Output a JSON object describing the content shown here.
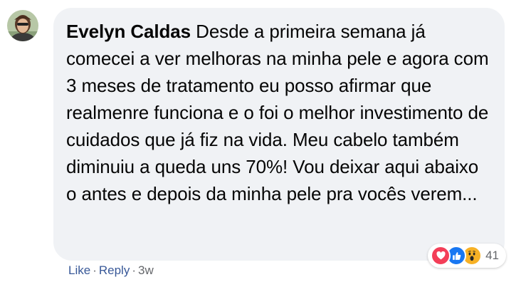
{
  "comment": {
    "author": "Evelyn Caldas",
    "text": "Desde a primeira semana já comecei a ver melhoras na minha pele e agora com 3 meses de tratamento eu posso afirmar que realmenre funciona e o foi o melhor investimento de cuidados que já fiz na vida. Meu cabelo também diminuiu a queda uns 70%! Vou deixar aqui abaixo o antes e depois da minha pele pra vocês verem..."
  },
  "reactions": {
    "icons": [
      "love-icon",
      "like-icon",
      "wow-icon"
    ],
    "count": "41"
  },
  "actions": {
    "like": "Like",
    "separator": "·",
    "reply": "Reply",
    "timestamp": "3w"
  },
  "colors": {
    "bubble": "#f0f2f5",
    "link": "#385898",
    "love": "#f33e58",
    "like": "#1877f2",
    "wow": "#f7b125",
    "secondary_text": "#65676b"
  }
}
